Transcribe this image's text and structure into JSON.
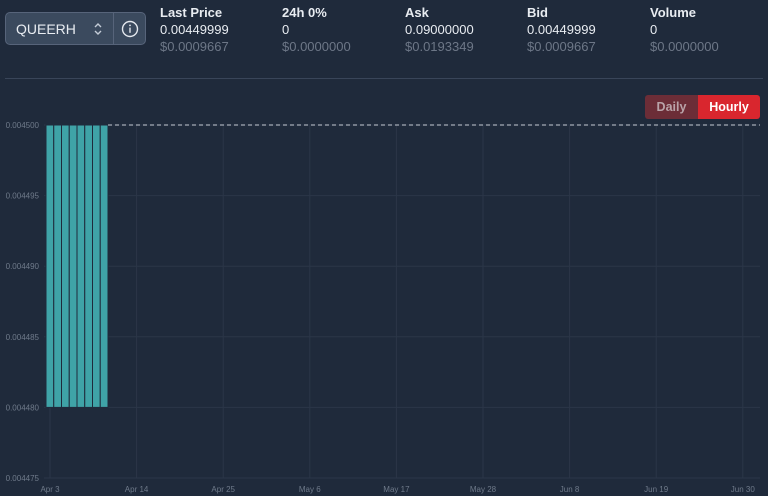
{
  "pair": {
    "symbol": "QUEERH"
  },
  "stats": [
    {
      "title": "Last Price",
      "value": "0.00449999",
      "usd": "$0.0009667"
    },
    {
      "title": "24h 0%",
      "value": "0",
      "usd": "$0.0000000"
    },
    {
      "title": "Ask",
      "value": "0.09000000",
      "usd": "$0.0193349"
    },
    {
      "title": "Bid",
      "value": "0.00449999",
      "usd": "$0.0009667"
    },
    {
      "title": "Volume",
      "value": "0",
      "usd": "$0.0000000"
    }
  ],
  "interval_toggle": {
    "daily_label": "Daily",
    "hourly_label": "Hourly",
    "selected": "Hourly"
  },
  "icons": {
    "chevron": "chevron-up-down-icon",
    "info": "info-circle-icon"
  },
  "colors": {
    "background": "#1f2a3b",
    "bar_fill": "#3fa3a7",
    "bar_stroke": "#1f2a3b",
    "selected_toggle": "#d9262e",
    "unselected_toggle": "#6c2d37"
  },
  "chart_data": {
    "type": "bar",
    "y_ticks": [
      "0.004500",
      "0.004495",
      "0.004490",
      "0.004485",
      "0.004480",
      "0.004475"
    ],
    "x_ticks": [
      "Apr 3",
      "Apr 14",
      "Apr 25",
      "May 6",
      "May 17",
      "May 28",
      "Jun 8",
      "Jun 19",
      "Jun 30"
    ],
    "ylim": [
      0.004475,
      0.0045
    ],
    "reference_line": 0.0045,
    "bars": [
      {
        "low": 0.00448,
        "high": 0.0045
      },
      {
        "low": 0.00448,
        "high": 0.0045
      },
      {
        "low": 0.00448,
        "high": 0.0045
      },
      {
        "low": 0.00448,
        "high": 0.0045
      },
      {
        "low": 0.00448,
        "high": 0.0045
      },
      {
        "low": 0.00448,
        "high": 0.0045
      },
      {
        "low": 0.00448,
        "high": 0.0045
      },
      {
        "low": 0.00448,
        "high": 0.0045
      }
    ]
  }
}
